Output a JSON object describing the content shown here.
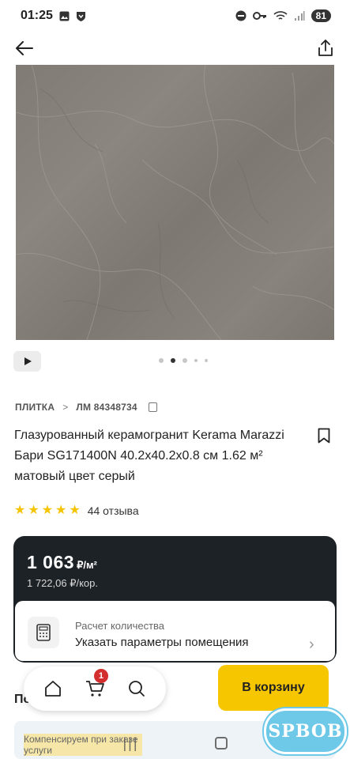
{
  "status": {
    "time": "01:25",
    "battery": "81"
  },
  "product": {
    "breadcrumb": {
      "category": "ПЛИТКА",
      "sku": "ЛМ 84348734"
    },
    "title": "Глазурованный керамогранит Kerama Marazzi Бари SG171400N 40.2x40.2x0.8 см 1.62 м² матовый цвет серый",
    "rating": 5,
    "reviews": "44 отзыва"
  },
  "price": {
    "value": "1 063",
    "unit": "₽/м²",
    "per_box": "1 722,06 ₽/кор."
  },
  "quantity": {
    "label": "Расчет количества",
    "value": "Указать параметры помещения"
  },
  "cart": {
    "badge": "1",
    "button_label": "В корзину"
  },
  "section_peek": "По                    ра",
  "promo_text": "Компенсируем при заказе услуги",
  "watermark": "SPBOB",
  "gallery": {
    "count": 5,
    "active": 1
  },
  "colors": {
    "accent": "#f6c700",
    "card": "#1d2227",
    "star": "#f5c400",
    "badge": "#d32f2f"
  }
}
